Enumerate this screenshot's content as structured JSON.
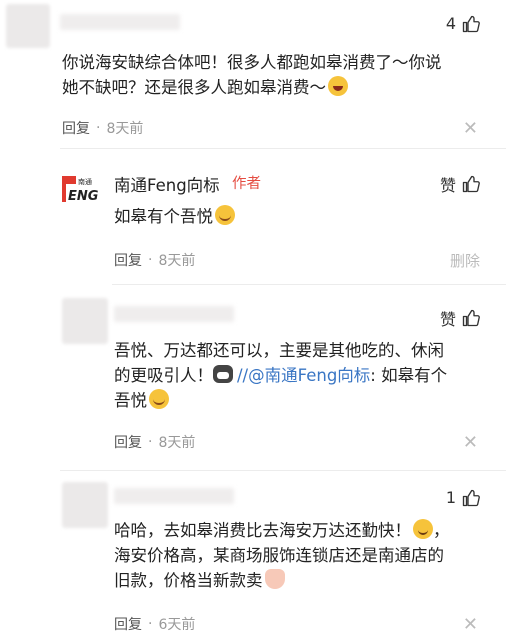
{
  "comments": [
    {
      "text_lines": [
        "你说海安缺综合体吧！很多人都跑如皋消费了～你说",
        "她不缺吧？还是很多人跑如皋消费～"
      ],
      "emoji": "laugh-emoji",
      "reply_label": "回复",
      "time": "8天前",
      "likes": "4",
      "close_symbol": "✕"
    },
    {
      "name": "南通Feng向标",
      "author_badge": "作者",
      "logo_text": "ENG",
      "logo_subtext": "南通",
      "text": "如皋有个吾悦",
      "emoji": "blush-emoji",
      "reply_label": "回复",
      "time": "8天前",
      "like_label": "赞",
      "delete_label": "删除"
    },
    {
      "text_line1": "吾悦、万达都还可以，主要是其他吃的、休闲",
      "text_line2_pre": "的更吸引人！",
      "text_line2_mention": "//@南通Feng向标",
      "text_line2_post": ": 如皋有个",
      "text_line3": "吾悦",
      "reply_label": "回复",
      "time": "8天前",
      "like_label": "赞",
      "close_symbol": "✕"
    },
    {
      "text_lines": [
        "哈哈，去如皋消费比去海安万达还勤快！",
        "海安价格高，某商场服饰连锁店还是南通店的",
        "旧款，价格当新款卖"
      ],
      "trailing_punct": "，",
      "reply_label": "回复",
      "time": "6天前",
      "likes": "1",
      "close_symbol": "✕"
    }
  ],
  "colors": {
    "author_badge": "#e54d42",
    "mention": "#3a76c4",
    "meta": "#999999",
    "divider": "#ececec"
  }
}
